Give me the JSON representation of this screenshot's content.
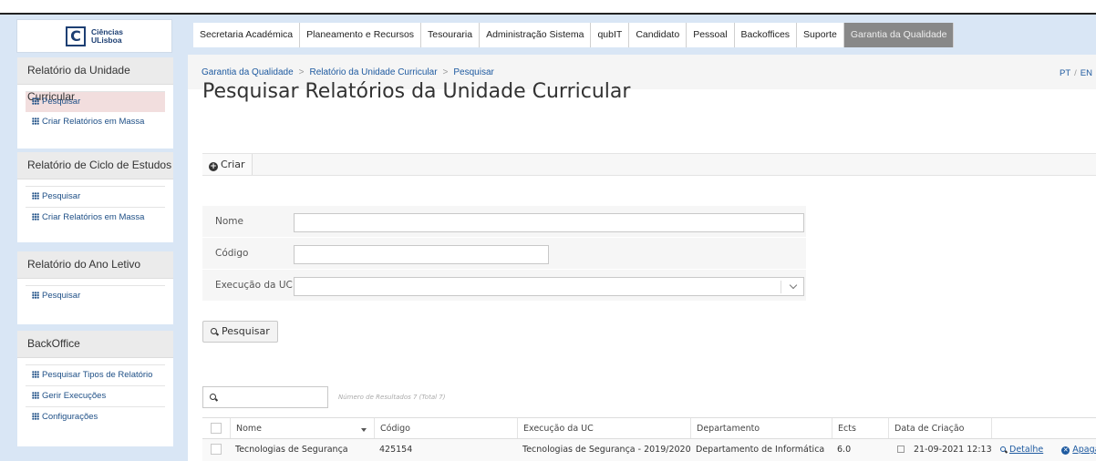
{
  "logo": {
    "mark": "C",
    "line1": "Ciências",
    "line2": "ULisboa"
  },
  "topnav": [
    "Secretaria Académica",
    "Planeamento e Recursos",
    "Tesouraria",
    "Administração Sistema",
    "qubIT",
    "Candidato",
    "Pessoal",
    "Backoffices",
    "Suporte",
    "Garantia da Qualidade"
  ],
  "sidebar": {
    "panels": [
      {
        "title": "Relatório da Unidade Curricular",
        "items": [
          "Pesquisar",
          "Criar Relatórios em Massa"
        ]
      },
      {
        "title": "Relatório de Ciclo de Estudos",
        "items": [
          "Pesquisar",
          "Criar Relatórios em Massa"
        ]
      },
      {
        "title": "Relatório do Ano Letivo",
        "items": [
          "Pesquisar"
        ]
      },
      {
        "title": "BackOffice",
        "items": [
          "Pesquisar Tipos de Relatório",
          "Gerir Execuções",
          "Configurações"
        ]
      }
    ]
  },
  "breadcrumb": [
    "Garantia da Qualidade",
    "Relatório da Unidade Curricular",
    "Pesquisar"
  ],
  "lang": {
    "pt": "PT",
    "sep": "/",
    "en": "EN"
  },
  "page_title": "Pesquisar Relatórios da Unidade Curricular",
  "actions": {
    "create": "Criar"
  },
  "form": {
    "name_label": "Nome",
    "name_value": "",
    "code_label": "Código",
    "code_value": "",
    "execution_label": "Execução da UC",
    "execution_value": "",
    "search_button": "Pesquisar"
  },
  "filter": {
    "value": "",
    "results_text": "Número de Resultados 7 (Total 7)"
  },
  "table": {
    "headers": [
      "Nome",
      "Código",
      "Execução da UC",
      "Departamento",
      "Ects",
      "Data de Criação"
    ],
    "rows": [
      {
        "nome": "Tecnologias de Segurança",
        "codigo": "425154",
        "execucao": "Tecnologias de Segurança - 2019/2020",
        "departamento": "Departamento de Informática",
        "ects": "6.0",
        "data": "21-09-2021 12:13",
        "detail": "Detalhe",
        "delete": "Apagar"
      }
    ]
  }
}
